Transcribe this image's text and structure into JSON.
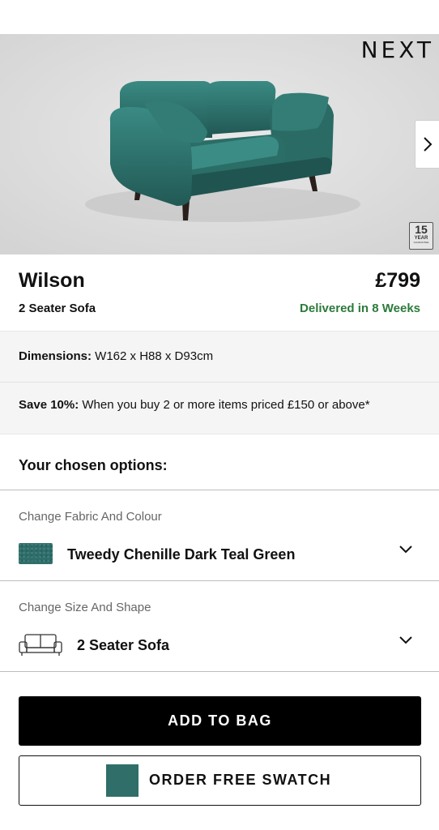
{
  "hero": {
    "brand": "NEXT",
    "guarantee_number": "15",
    "guarantee_unit": "YEAR",
    "guarantee_text": "GUARANTEE"
  },
  "product": {
    "title": "Wilson",
    "price": "£799",
    "subtitle": "2 Seater Sofa",
    "delivery": "Delivered in 8 Weeks"
  },
  "info": {
    "dimensions_label": "Dimensions:",
    "dimensions_value": " W162 x H88 x D93cm",
    "save_label": "Save 10%:",
    "save_value": " When you buy 2 or more items priced £150 or above*"
  },
  "options": {
    "heading": "Your chosen options:",
    "fabric_label": "Change Fabric And Colour",
    "fabric_value": "Tweedy Chenille Dark Teal Green",
    "size_label": "Change Size And Shape",
    "size_value": "2 Seater Sofa"
  },
  "actions": {
    "add_to_bag": "ADD TO BAG",
    "order_swatch": "ORDER FREE SWATCH"
  },
  "colors": {
    "accent": "#000000",
    "delivery_green": "#2c7a3a",
    "teal": "#2e6e6a"
  }
}
